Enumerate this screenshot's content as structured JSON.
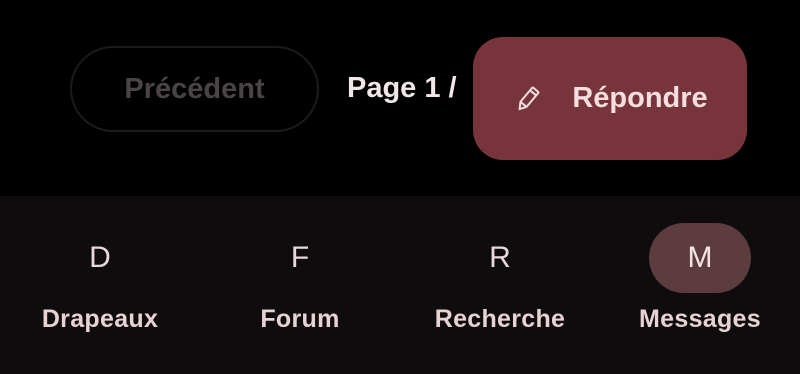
{
  "pagination": {
    "prev_label": "Précédent",
    "page_text": "Page 1 /",
    "reply_label": "Répondre",
    "reply_icon": "pencil-icon"
  },
  "bottom_nav": {
    "items": [
      {
        "glyph": "D",
        "label": "Drapeaux",
        "active": false
      },
      {
        "glyph": "F",
        "label": "Forum",
        "active": false
      },
      {
        "glyph": "R",
        "label": "Recherche",
        "active": false
      },
      {
        "glyph": "M",
        "label": "Messages",
        "active": true
      }
    ]
  },
  "colors": {
    "background": "#000000",
    "nav_background": "#0f0c0d",
    "accent": "#77353b",
    "active_indicator": "#5c3c3e",
    "text": "#f3e6e6",
    "disabled_text": "#4a4445"
  }
}
